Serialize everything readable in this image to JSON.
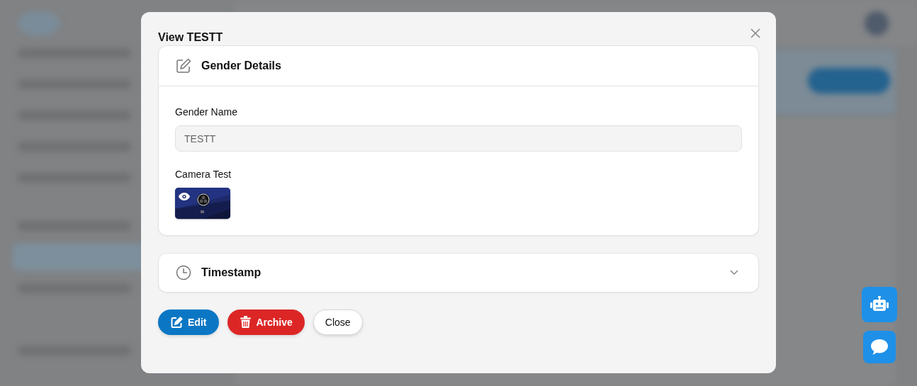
{
  "modal": {
    "title": "View TESTT"
  },
  "details_card": {
    "title": "Gender Details",
    "fields": [
      {
        "kind": "text",
        "label": "Gender Name",
        "value": "TESTT"
      },
      {
        "label": "Camera Test"
      }
    ]
  },
  "timestamp_card": {
    "title": "Timestamp",
    "expanded": false
  },
  "buttons": [
    {
      "kind": "edit",
      "label": "Edit"
    },
    {
      "kind": "archive",
      "label": "Archive"
    },
    {
      "kind": "close",
      "label": "Close"
    }
  ]
}
